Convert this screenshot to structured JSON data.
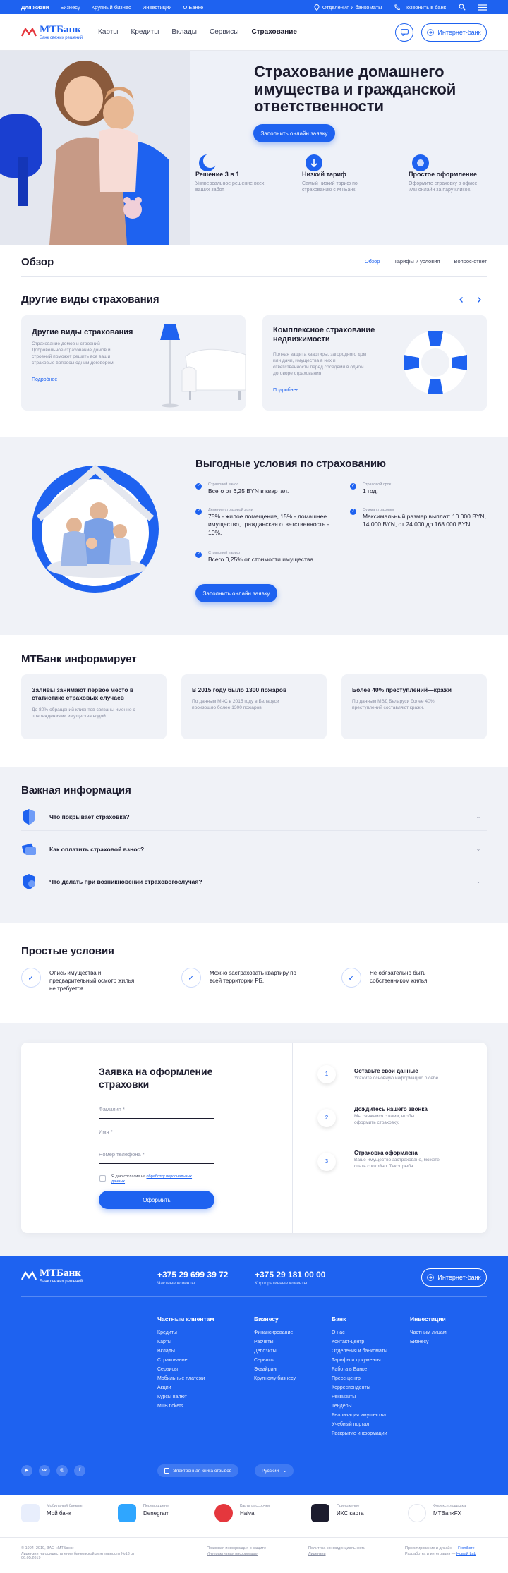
{
  "topbar": {
    "links": [
      "Для жизни",
      "Бизнесу",
      "Крупный бизнес",
      "Инвестиции",
      "О Банке"
    ],
    "branches": "Отделения и банкоматы",
    "call": "Позвонить в банк"
  },
  "brand": {
    "name": "МТБанк",
    "tagline": "Банк свежих решений"
  },
  "nav": {
    "menu": [
      "Карты",
      "Кредиты",
      "Вклады",
      "Сервисы",
      "Страхование"
    ],
    "internet_bank": "Интернет-банк"
  },
  "hero": {
    "title": "Страхование домашнего имущества и гражданской ответственности",
    "cta": "Заполнить онлайн заявку",
    "features": [
      {
        "title": "Решение 3 в 1",
        "text": "Универсальное решение всех ваших забот."
      },
      {
        "title": "Низкий тариф",
        "text": "Самый низкий тариф по страхованию с МТБанк."
      },
      {
        "title": "Простое оформление",
        "text": "Оформите страховку в офисе или онлайн за пару кликов."
      }
    ]
  },
  "overview": {
    "title": "Обзор",
    "tabs": [
      "Обзор",
      "Тарифы и условия",
      "Вопрос-ответ"
    ]
  },
  "other": {
    "title": "Другие виды страхования",
    "cards": [
      {
        "title": "Другие виды страхования",
        "text": "Страхование домов и строений Добровольное страхование домов и строений поможет решить все ваши страховые вопросы одним договором.",
        "link": "Подробнее"
      },
      {
        "title": "Комплексное страхование недвижимости",
        "text": "Полная защита квартиры, загородного дом или дачи, имущества в них и ответственности перед соседями в одном договоре страхования",
        "link": "Подробнее"
      }
    ]
  },
  "conditions": {
    "title": "Выгодные условия по страхованию",
    "items": [
      {
        "label": "Страховой взнос",
        "value": "Всего от 6,25 BYN в квартал."
      },
      {
        "label": "Страховой срок",
        "value": "1 год."
      },
      {
        "label": "Деление страховой доли",
        "value": "75% - жилое помещение, 15% - домашнее имущество, гражданская ответственность - 10%."
      },
      {
        "label": "Сумма страховки",
        "value": "Максимальный размер выплат: 10 000 BYN, 14 000 BYN, от 24 000 до 168 000 BYN."
      },
      {
        "label": "Страховой тариф",
        "value": "Всего 0,25% от стоимости имущества."
      }
    ],
    "cta": "Заполнить онлайн заявку"
  },
  "informs": {
    "title": "МТБанк информирует",
    "cards": [
      {
        "title": "Заливы занимают первое место в статистике страховых случаев",
        "text": "До 80% обращений клиентов связаны именно с повреждениями имущества водой."
      },
      {
        "title": "В 2015 году было 1300 пожаров",
        "text": "По данным МЧС в 2015 году в Беларуси произошло более 1300 пожаров."
      },
      {
        "title": "Более 40% преступлений—кражи",
        "text": "По данным МВД Беларуси более 40% преступлений составляют кражи."
      }
    ]
  },
  "important": {
    "title": "Важная информация",
    "items": [
      "Что покрывает страховка?",
      "Как оплатить страховой взнос?",
      "Что делать при возникновении страховогослучая?"
    ]
  },
  "simple": {
    "title": "Простые условия",
    "items": [
      "Опись имущества и предварительный осмотр жилья не требуется.",
      "Можно застраховать квартиру по всей территории РБ.",
      "Не обязательно быть собственником жилья."
    ]
  },
  "form": {
    "title": "Заявка на оформление страховки",
    "fields": [
      "Фамилия *",
      "Имя *",
      "Номер телефона *"
    ],
    "consent_prefix": "Я даю согласие на ",
    "consent_link": "обработку персональных данных",
    "submit": "Оформить",
    "steps": [
      {
        "num": "1",
        "title": "Оставьте свои данные",
        "text": "Укажите основную информацию о себе."
      },
      {
        "num": "2",
        "title": "Дождитесь нашего звонка",
        "text": "Мы свяжемся с вами, чтобы оформить страховку."
      },
      {
        "num": "3",
        "title": "Страховка оформлена",
        "text": "Ваше имущество застраховано, можете спать спокойно. Текст рыба."
      }
    ]
  },
  "footer": {
    "phones": [
      {
        "number": "+375 29 699 39 72",
        "label": "Частные клиенты"
      },
      {
        "number": "+375 29 181 00 00",
        "label": "Корпоративные клиенты"
      }
    ],
    "internet_bank": "Интернет-банк",
    "columns": [
      {
        "title": "Частным клиентам",
        "items": [
          "Кредиты",
          "Карты",
          "Вклады",
          "Страхование",
          "Сервисы",
          "Мобильные платежи",
          "Акции",
          "Курсы валют",
          "MTB.tickets"
        ]
      },
      {
        "title": "Бизнесу",
        "items": [
          "Финансирование",
          "Расчёты",
          "Депозиты",
          "Сервисы",
          "Эквайринг",
          "Крупному бизнесу"
        ]
      },
      {
        "title": "Банк",
        "items": [
          "О нас",
          "Контакт-центр",
          "Отделения и банкоматы",
          "Тарифы и документы",
          "Работа в Банке",
          "Пресс-центр",
          "Корреспонденты",
          "Реквизиты",
          "Тендеры",
          "Реализация имущества",
          "Учебный портал",
          "Раскрытие информации"
        ]
      },
      {
        "title": "Инвестиции",
        "items": [
          "Частным лицам",
          "Бизнесу"
        ]
      }
    ],
    "socials": [
      "youtube-icon",
      "vk-icon",
      "instagram-icon",
      "facebook-icon"
    ],
    "feedback_book": "Электронная книга отзывов",
    "language": "Русский"
  },
  "apps": [
    {
      "caption": "Мобильный банкинг",
      "name": "Мой банк",
      "color": "#e8eefc"
    },
    {
      "caption": "Перевод денег",
      "name": "Denegram",
      "color": "#2fa6ff"
    },
    {
      "caption": "Карта рассрочки",
      "name": "Halva",
      "color": "#e5373d"
    },
    {
      "caption": "Приложение",
      "name": "ИКС карта",
      "color": "#1c1c2e"
    },
    {
      "caption": "Форекс-площадка",
      "name": "MTBankFX",
      "color": "#1e62f0"
    }
  ],
  "legal": {
    "copyright": "© 1994–2019, ЗАО «МТБанк»",
    "license": "Лицензия на осуществление банковской деятельности №13 от 06.05.2019",
    "links1": [
      "Правовая информация о защите",
      "Интерактивная информация"
    ],
    "links2": [
      "Политика конфиденциальности",
      "Лицензии"
    ],
    "design_prefix": "Проектирование и дизайн —",
    "design_name": "Frontkore",
    "dev_prefix": "Разработка и интеграция —",
    "dev_name": "Новый Lab"
  },
  "colors": {
    "accent": "#1e62f0",
    "light_bg": "#eef1f8"
  }
}
